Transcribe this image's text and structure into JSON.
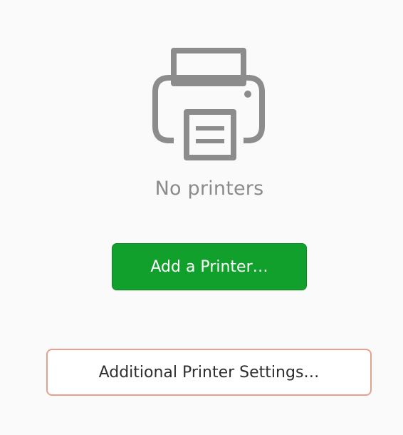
{
  "empty_state": {
    "icon": "printer-icon",
    "message": "No printers"
  },
  "actions": {
    "add_printer_label": "Add a Printer…",
    "additional_settings_label": "Additional Printer Settings…"
  },
  "colors": {
    "background": "#fafafa",
    "primary_button": "#12a02c",
    "primary_button_text": "#ffffff",
    "secondary_button_border": "#e8a08a",
    "muted_text": "#8a8a8a",
    "icon": "#8c8c8c"
  }
}
